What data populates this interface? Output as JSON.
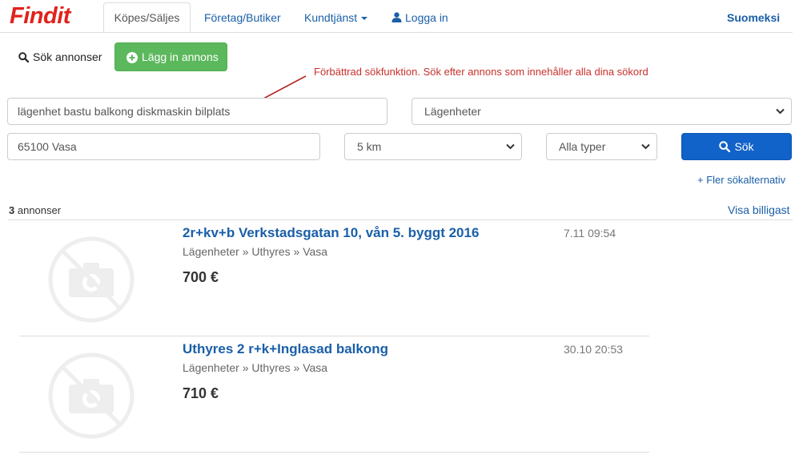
{
  "brand": {
    "logo": "Findit",
    "logo_color": "#e0231c"
  },
  "nav": {
    "tab_active": "Köpes/Säljes",
    "tab_business": "Företag/Butiker",
    "customer_service": "Kundtjänst",
    "login": "Logga in",
    "language": "Suomeksi"
  },
  "actions": {
    "search_ads": "Sök annonser",
    "add_ad": "Lägg in annons"
  },
  "hint": "Förbättrad sökfunktion. Sök efter annons som innehåller alla dina sökord",
  "search": {
    "query": "lägenhet bastu balkong diskmaskin bilplats",
    "category": "Lägenheter",
    "location": "65100 Vasa",
    "radius": "5 km",
    "type": "Alla typer",
    "submit": "Sök",
    "more_options": "+ Fler sökalternativ"
  },
  "results": {
    "count": "3",
    "count_label": "annonser",
    "sort_label": "Visa billigast"
  },
  "listings": [
    {
      "title": "2r+kv+b Verkstadsgatan 10, vån 5. byggt 2016",
      "date": "7.11 09:54",
      "breadcrumb": "Lägenheter » Uthyres » Vasa",
      "price": "700 €"
    },
    {
      "title": "Uthyres 2 r+k+Inglasad balkong",
      "date": "30.10 20:53",
      "breadcrumb": "Lägenheter » Uthyres » Vasa",
      "price": "710 €"
    }
  ],
  "colors": {
    "link": "#1a5fa8",
    "primary_button": "#1162c9",
    "success_button": "#5cb85c",
    "hint": "#c9302c"
  }
}
